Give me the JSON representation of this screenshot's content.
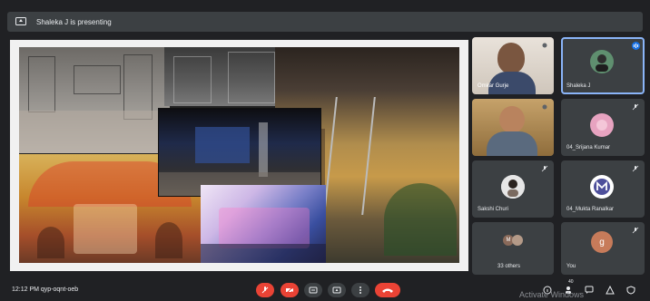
{
  "topbar": {
    "presenting_text": "Shaleka J is presenting",
    "icon": "present-icon"
  },
  "stage": {
    "icons": [
      "set-photo",
      "studio-photo",
      "house-interior-photo",
      "temple-set-photo",
      "blue-stage-photo",
      "pink-set-photo"
    ]
  },
  "participants": [
    {
      "name": "Omkar Gurje",
      "type": "video"
    },
    {
      "name": "Shaleka J",
      "type": "avatar",
      "avatar_color": "#5f8f6f"
    },
    {
      "name": "",
      "type": "video"
    },
    {
      "name": "04_Srijana Kumar",
      "type": "avatar",
      "avatar_color": "#e7a3c0"
    },
    {
      "name": "Sakshi Churi",
      "type": "avatar",
      "avatar_color": "#d9d9d9"
    },
    {
      "name": "04_Mukta Ranalkar",
      "type": "avatar",
      "avatar_letter": "M",
      "avatar_color": "#4d4f9b"
    },
    {
      "name": "33 others",
      "type": "group"
    },
    {
      "name": "You",
      "type": "avatar",
      "avatar_letter": "g",
      "avatar_color": "#c77b5a"
    }
  ],
  "bottombar": {
    "time_code": "12:12 PM   qyp-oqnt-oeb",
    "watermark": "Activate Windows",
    "participant_count": "40"
  },
  "colors": {
    "end_call": "#ea4335",
    "active_outline": "#8ab4f8"
  }
}
